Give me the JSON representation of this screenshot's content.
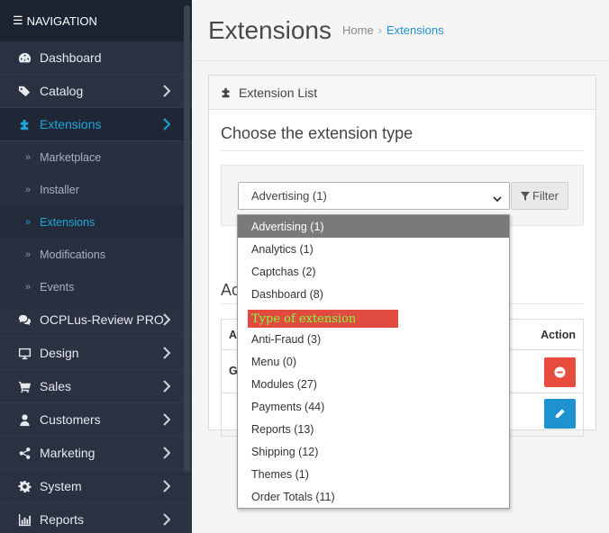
{
  "sidebar": {
    "header": "NAVIGATION",
    "items": [
      {
        "label": "Dashboard",
        "icon": "dashboard-icon",
        "chevron": false
      },
      {
        "label": "Catalog",
        "icon": "tags-icon",
        "chevron": true
      },
      {
        "label": "Extensions",
        "icon": "puzzle-icon",
        "chevron": true,
        "active": true
      }
    ],
    "subitems": [
      {
        "label": "Marketplace"
      },
      {
        "label": "Installer"
      },
      {
        "label": "Extensions",
        "active": true
      },
      {
        "label": "Modifications"
      },
      {
        "label": "Events"
      }
    ],
    "items_after": [
      {
        "label": "OCPLus-Review PRO",
        "icon": "comments-icon"
      },
      {
        "label": "Design",
        "icon": "monitor-icon"
      },
      {
        "label": "Sales",
        "icon": "cart-icon"
      },
      {
        "label": "Customers",
        "icon": "user-icon"
      },
      {
        "label": "Marketing",
        "icon": "share-icon"
      },
      {
        "label": "System",
        "icon": "gear-icon"
      },
      {
        "label": "Reports",
        "icon": "bar-chart-icon"
      }
    ]
  },
  "header": {
    "title": "Extensions",
    "breadcrumb": {
      "home": "Home",
      "sep": "›",
      "current": "Extensions"
    }
  },
  "panel": {
    "title": "Extension List",
    "section_title": "Choose the extension type",
    "select_value": "Advertising (1)",
    "filter_label": "Filter",
    "sub_title_partial": "Ac",
    "table": {
      "col_left_partial": "A",
      "col_action": "Action",
      "row1_left_partial": "G"
    }
  },
  "dropdown": {
    "options": [
      "Advertising (1)",
      "Analytics (1)",
      "Captchas (2)",
      "Dashboard (8)",
      "",
      "Anti-Fraud (3)",
      "Menu (0)",
      "Modules (27)",
      "Payments (44)",
      "Reports (13)",
      "Shipping (12)",
      "Themes (1)",
      "Order Totals (11)"
    ],
    "selected_index": 0
  },
  "annotation": {
    "text": "Type of extension"
  },
  "colors": {
    "accent": "#1fa4dc",
    "danger": "#e74c3c",
    "primary": "#1e91cf",
    "annotation_bg": "#e24b3f",
    "annotation_text": "#7dff40"
  }
}
